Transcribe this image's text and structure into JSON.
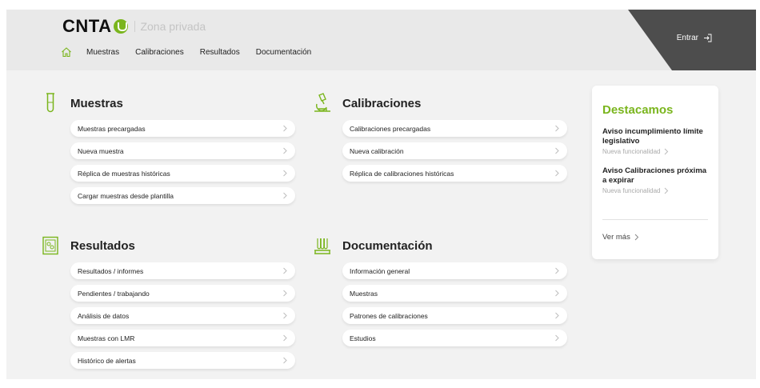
{
  "brand": {
    "name": "CNTA",
    "subtitle": "Zona privada",
    "accent": "#7ab51d"
  },
  "nav": {
    "home_icon": "home-icon",
    "items": [
      "Muestras",
      "Calibraciones",
      "Resultados",
      "Documentación"
    ]
  },
  "login": {
    "label": "Entrar",
    "icon": "login-icon"
  },
  "sections": {
    "muestras": {
      "title": "Muestras",
      "icon": "test-tube-icon",
      "links": [
        "Muestras precargadas",
        "Nueva muestra",
        "Réplica de muestras históricas",
        "Cargar muestras desde plantilla"
      ]
    },
    "calibraciones": {
      "title": "Calibraciones",
      "icon": "microscope-icon",
      "links": [
        "Calibraciones precargadas",
        "Nueva calibración",
        "Réplica de calibraciones históricas"
      ]
    },
    "resultados": {
      "title": "Resultados",
      "icon": "report-icon",
      "links": [
        "Resultados / informes",
        "Pendientes / trabajando",
        "Análisis de datos",
        "Muestras con LMR",
        "Histórico de alertas"
      ]
    },
    "documentacion": {
      "title": "Documentación",
      "icon": "lab-rack-icon",
      "links": [
        "Información general",
        "Muestras",
        "Patrones de calibraciones",
        "Estudios"
      ]
    }
  },
  "featured": {
    "title": "Destacamos",
    "items": [
      {
        "title": "Aviso incumplimiento límite legislativo",
        "sub": "Nueva funcionalidad"
      },
      {
        "title": "Aviso Calibraciones próxima a expirar",
        "sub": "Nueva funcionalidad"
      }
    ],
    "more": "Ver más"
  }
}
